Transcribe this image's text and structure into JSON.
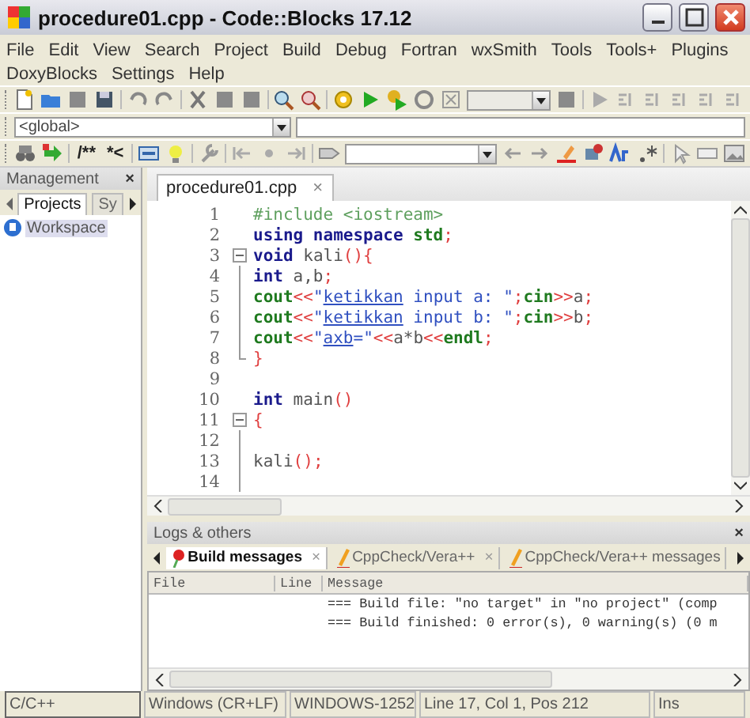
{
  "window": {
    "title": "procedure01.cpp - Code::Blocks 17.12"
  },
  "menu_rows": [
    [
      "File",
      "Edit",
      "View",
      "Search",
      "Project",
      "Build",
      "Debug",
      "Fortran",
      "wxSmith",
      "Tools",
      "Tools+",
      "Plugins"
    ],
    [
      "DoxyBlocks",
      "Settings",
      "Help"
    ]
  ],
  "toolbar": {
    "scope_combo": "<global>",
    "doc_buttons": [
      "/**",
      "*<"
    ]
  },
  "management": {
    "title": "Management",
    "close": "×",
    "tabs": [
      {
        "label": "Projects",
        "selected": true
      },
      {
        "label": "Sy",
        "selected": false
      }
    ],
    "tree": [
      {
        "label": "Workspace",
        "selected": true
      }
    ]
  },
  "editor": {
    "tab": {
      "label": "procedure01.cpp",
      "close": "×"
    },
    "lines": [
      {
        "number": "1",
        "kind": "plain",
        "tokens": [
          {
            "kind": "pre",
            "text": "#include <iostream>"
          }
        ]
      },
      {
        "number": "2",
        "kind": "plain",
        "tokens": [
          {
            "kind": "kw",
            "text": "using namespace "
          },
          {
            "kind": "kw2",
            "text": "std"
          },
          {
            "kind": "op",
            "text": ";"
          }
        ]
      },
      {
        "number": "3",
        "kind": "fold-start",
        "tokens": [
          {
            "kind": "kw",
            "text": "void"
          },
          {
            "kind": "id",
            "text": " kali"
          },
          {
            "kind": "op",
            "text": "(){"
          }
        ]
      },
      {
        "number": "4",
        "kind": "fold-body",
        "tokens": [
          {
            "kind": "kw",
            "text": "int"
          },
          {
            "kind": "id",
            "text": " a,b"
          },
          {
            "kind": "op",
            "text": ";"
          }
        ]
      },
      {
        "number": "5",
        "kind": "fold-body",
        "tokens": [
          {
            "kind": "kw2",
            "text": "cout"
          },
          {
            "kind": "op",
            "text": "<<"
          },
          {
            "kind": "str",
            "text": "\""
          },
          {
            "kind": "link",
            "text": "ketikkan"
          },
          {
            "kind": "str",
            "text": " input a: \""
          },
          {
            "kind": "op",
            "text": ";"
          },
          {
            "kind": "kw2",
            "text": "cin"
          },
          {
            "kind": "op",
            "text": ">>"
          },
          {
            "kind": "id",
            "text": "a"
          },
          {
            "kind": "op",
            "text": ";"
          }
        ]
      },
      {
        "number": "6",
        "kind": "fold-body",
        "tokens": [
          {
            "kind": "kw2",
            "text": "cout"
          },
          {
            "kind": "op",
            "text": "<<"
          },
          {
            "kind": "str",
            "text": "\""
          },
          {
            "kind": "link",
            "text": "ketikkan"
          },
          {
            "kind": "str",
            "text": " input b: \""
          },
          {
            "kind": "op",
            "text": ";"
          },
          {
            "kind": "kw2",
            "text": "cin"
          },
          {
            "kind": "op",
            "text": ">>"
          },
          {
            "kind": "id",
            "text": "b"
          },
          {
            "kind": "op",
            "text": ";"
          }
        ]
      },
      {
        "number": "7",
        "kind": "fold-body",
        "tokens": [
          {
            "kind": "kw2",
            "text": "cout"
          },
          {
            "kind": "op",
            "text": "<<"
          },
          {
            "kind": "str",
            "text": "\""
          },
          {
            "kind": "link",
            "text": "axb"
          },
          {
            "kind": "str",
            "text": "=\""
          },
          {
            "kind": "op",
            "text": "<<"
          },
          {
            "kind": "id",
            "text": "a*b"
          },
          {
            "kind": "op",
            "text": "<<"
          },
          {
            "kind": "kw2",
            "text": "endl"
          },
          {
            "kind": "op",
            "text": ";"
          }
        ]
      },
      {
        "number": "8",
        "kind": "fold-end",
        "tokens": [
          {
            "kind": "op",
            "text": "}"
          }
        ]
      },
      {
        "number": "9",
        "kind": "plain"
      },
      {
        "number": "10",
        "kind": "plain",
        "tokens": [
          {
            "kind": "kw",
            "text": "int"
          },
          {
            "kind": "id",
            "text": " main"
          },
          {
            "kind": "op",
            "text": "()"
          }
        ]
      },
      {
        "number": "11",
        "kind": "fold-start",
        "tokens": [
          {
            "kind": "op",
            "text": "{"
          }
        ]
      },
      {
        "number": "12",
        "kind": "fold-body"
      },
      {
        "number": "13",
        "kind": "fold-body",
        "tokens": [
          {
            "kind": "id",
            "text": "kali"
          },
          {
            "kind": "op",
            "text": "();"
          }
        ]
      },
      {
        "number": "14",
        "kind": "fold-body"
      }
    ]
  },
  "logs": {
    "title": "Logs & others",
    "close": "×",
    "tabs": [
      {
        "label": "Build messages",
        "close": "×",
        "selected": true
      },
      {
        "label": "CppCheck/Vera++",
        "close": "×",
        "selected": false
      },
      {
        "label": "CppCheck/Vera++ messages",
        "selected": false
      }
    ],
    "table": {
      "columns": [
        "File",
        "Line",
        "Message"
      ],
      "rows": [
        [
          "",
          "",
          "=== Build file: \"no target\" in \"no project\" (comp"
        ],
        [
          "",
          "",
          "=== Build finished: 0 error(s), 0 warning(s) (0 m"
        ]
      ]
    }
  },
  "status_bar": [
    "C/C++",
    "Windows (CR+LF)",
    "WINDOWS-1252",
    "Line 17, Col 1, Pos 212",
    "Ins"
  ]
}
